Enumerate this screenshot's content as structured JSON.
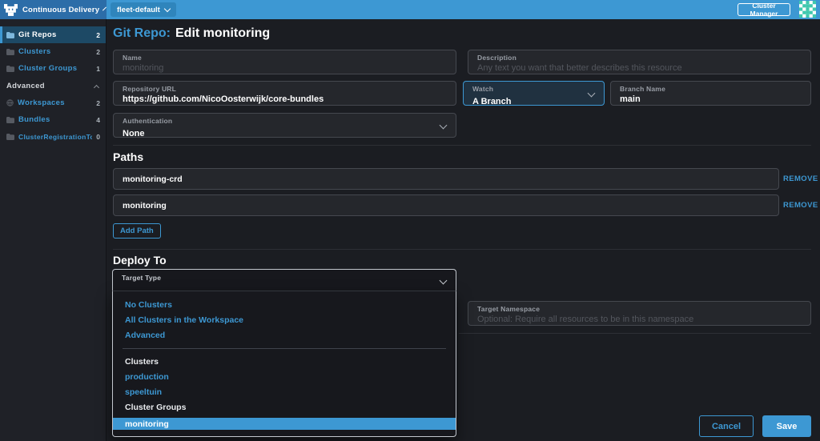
{
  "topbar": {
    "product": "Continuous Delivery",
    "workspace_selector": "fleet-default",
    "cluster_manager_label": "Cluster Manager"
  },
  "sidebar": {
    "items": [
      {
        "label": "Git Repos",
        "count": "2"
      },
      {
        "label": "Clusters",
        "count": "2"
      },
      {
        "label": "Cluster Groups",
        "count": "1"
      }
    ],
    "advanced_header": "Advanced",
    "advanced_items": [
      {
        "label": "Workspaces",
        "count": "2"
      },
      {
        "label": "Bundles",
        "count": "4"
      },
      {
        "label": "ClusterRegistrationTokens",
        "count": "0"
      }
    ]
  },
  "page": {
    "title_prefix": "Git Repo:",
    "title_name": "Edit monitoring"
  },
  "form": {
    "name": {
      "label": "Name",
      "placeholder": "monitoring"
    },
    "description": {
      "label": "Description",
      "placeholder": "Any text you want that better describes this resource"
    },
    "repository_url": {
      "label": "Repository URL",
      "value": "https://github.com/NicoOosterwijk/core-bundles"
    },
    "watch": {
      "label": "Watch",
      "value": "A Branch"
    },
    "branch_name": {
      "label": "Branch Name",
      "value": "main"
    },
    "authentication": {
      "label": "Authentication",
      "value": "None"
    }
  },
  "paths": {
    "heading": "Paths",
    "entries": [
      "monitoring-crd",
      "monitoring"
    ],
    "remove_label": "REMOVE",
    "add_button": "Add Path"
  },
  "deploy_to": {
    "heading": "Deploy To",
    "target_type_label": "Target Type",
    "menu": {
      "actions": [
        "No Clusters",
        "All Clusters in the Workspace",
        "Advanced"
      ],
      "group1_label": "Clusters",
      "group1_options": [
        "production",
        "speeltuin"
      ],
      "group2_label": "Cluster Groups",
      "highlighted_option": "monitoring"
    },
    "target_namespace": {
      "label": "Target Namespace",
      "placeholder": "Optional: Require all resources to be in this namespace"
    }
  },
  "footer": {
    "cancel_label": "Cancel",
    "save_label": "Save"
  },
  "colors": {
    "accent": "#3d98d3",
    "topbar": "#3d98d3",
    "topbar_left": "#2c6da8",
    "nav_selected_bg": "#1d4965",
    "highlight_option_bg": "#3d98d3",
    "identicon_teal": "#3fc8ae"
  }
}
